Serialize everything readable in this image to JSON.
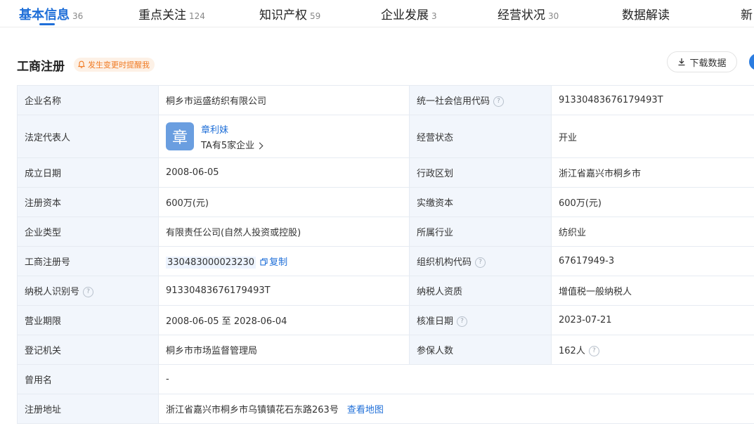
{
  "tabs": [
    {
      "label": "基本信息",
      "count": "36",
      "active": true
    },
    {
      "label": "重点关注",
      "count": "124"
    },
    {
      "label": "知识产权",
      "count": "59"
    },
    {
      "label": "企业发展",
      "count": "3"
    },
    {
      "label": "经营状况",
      "count": "30"
    },
    {
      "label": "数据解读",
      "count": ""
    },
    {
      "label": "新",
      "count": ""
    }
  ],
  "section": {
    "title": "工商注册",
    "remind_label": "发生变更时提醒我",
    "download_label": "下载数据"
  },
  "colors": {
    "accent": "#1f6fd8",
    "remind_text": "#f07a23",
    "remind_bg": "#fdf1e6",
    "key_bg": "#f2f6fc"
  },
  "icons": {
    "bell": "bell-icon",
    "download": "download-icon",
    "help": "question-circle-icon",
    "copy": "copy-icon",
    "chevron": "chevron-right-icon"
  },
  "info": {
    "company_name_label": "企业名称",
    "company_name": "桐乡市运盛纺织有限公司",
    "credit_code_label": "统一社会信用代码",
    "credit_code": "91330483676179493T",
    "legal_rep_label": "法定代表人",
    "legal_rep_avatar": "章",
    "legal_rep_name": "章利妹",
    "legal_rep_sub": "TA有5家企业",
    "status_label": "经营状态",
    "status": "开业",
    "founded_label": "成立日期",
    "founded": "2008-06-05",
    "region_label": "行政区划",
    "region": "浙江省嘉兴市桐乡市",
    "reg_capital_label": "注册资本",
    "reg_capital": "600万(元)",
    "paid_capital_label": "实缴资本",
    "paid_capital": "600万(元)",
    "type_label": "企业类型",
    "type": "有限责任公司(自然人投资或控股)",
    "industry_label": "所属行业",
    "industry": "纺织业",
    "reg_no_label": "工商注册号",
    "reg_no": "330483000023230",
    "copy_label": "复制",
    "org_code_label": "组织机构代码",
    "org_code": "67617949-3",
    "taxpayer_id_label": "纳税人识别号",
    "taxpayer_id": "91330483676179493T",
    "taxpayer_qual_label": "纳税人资质",
    "taxpayer_qual": "增值税一般纳税人",
    "term_label": "营业期限",
    "term": "2008-06-05 至 2028-06-04",
    "approve_date_label": "核准日期",
    "approve_date": "2023-07-21",
    "authority_label": "登记机关",
    "authority": "桐乡市市场监督管理局",
    "insured_label": "参保人数",
    "insured": "162人",
    "former_name_label": "曾用名",
    "former_name": "-",
    "address_label": "注册地址",
    "address": "浙江省嘉兴市桐乡市乌镇镇花石东路263号",
    "map_label": "查看地图"
  }
}
